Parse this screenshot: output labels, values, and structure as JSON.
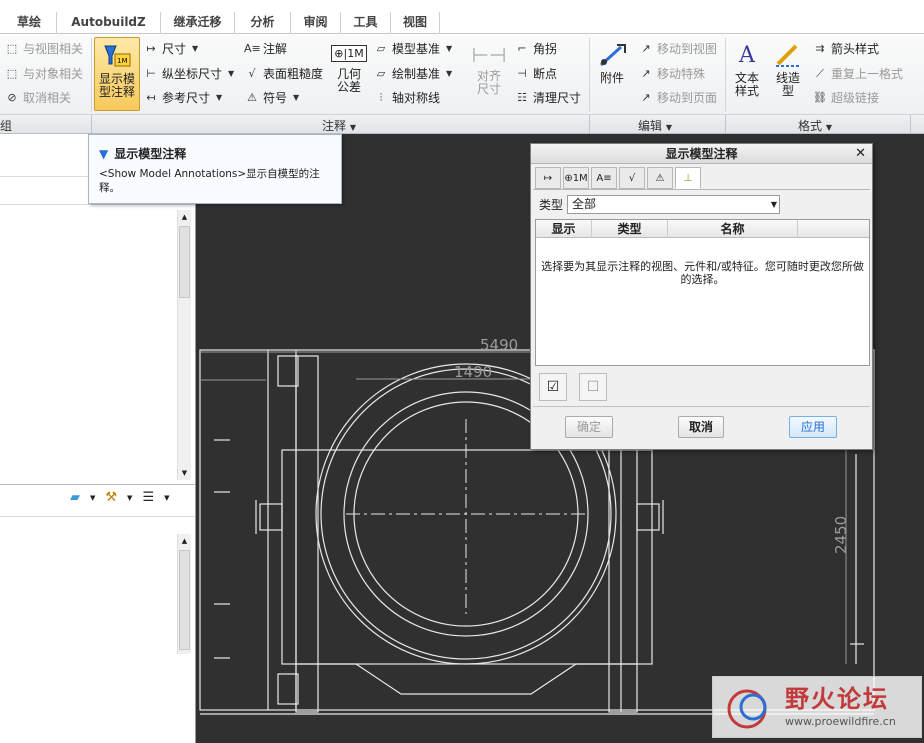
{
  "tabs": [
    "草绘",
    "AutobuildZ",
    "继承迁移",
    "分析",
    "审阅",
    "工具",
    "视图"
  ],
  "ribbon": {
    "relate": {
      "to_view": "与视图相关",
      "to_object": "与对象相关",
      "cancel": "取消相关"
    },
    "show_model_annotations": "显示模\n型注释",
    "dimension": "尺寸",
    "ordinate_dimension": "纵坐标尺寸",
    "reference_dimension": "参考尺寸",
    "note": "注解",
    "surface_finish": "表面粗糙度",
    "symbol": "符号",
    "geometric_tolerance": "几何\n公差",
    "model_datum": "模型基准",
    "draw_datum": "绘制基准",
    "axis_symmetry": "轴对称线",
    "align_dimension": "对齐\n尺寸",
    "corner": "角拐",
    "breakpoint": "断点",
    "clean_dimension": "清理尺寸",
    "attach": "附件",
    "move_to_view": "移动到视图",
    "move_special": "移动特殊",
    "move_to_page": "移动到页面",
    "text_style": "文本\n样式",
    "line_style": "线造\n型",
    "arrow_style": "箭头样式",
    "repeat_last_format": "重复上一格式",
    "hyperlink": "超级链接"
  },
  "groups": {
    "left": "组",
    "annotate": "注释",
    "edit": "编辑",
    "format": "格式"
  },
  "tooltip": {
    "title": "显示模型注释",
    "desc": "<Show Model Annotations>显示自模型的注释。"
  },
  "dialog": {
    "title": "显示模型注释",
    "type_label": "类型",
    "type_value": "全部",
    "columns": [
      "显示",
      "类型",
      "名称"
    ],
    "message": "选择要为其显示注释的视图、元件和/或特征。您可随时更改您所做的选择。",
    "ok": "确定",
    "cancel": "取消",
    "apply": "应用"
  },
  "drawing": {
    "dim_top": "5490",
    "dim_inner": "1490",
    "dim_right": "2450"
  },
  "watermark": {
    "name": "野火论坛",
    "url": "www.proewildfire.cn"
  },
  "colors": {
    "canvas": "#303030",
    "lines": "#e8e8e8",
    "dim": "#9a9a9a",
    "accent": "#1a5fb4"
  }
}
